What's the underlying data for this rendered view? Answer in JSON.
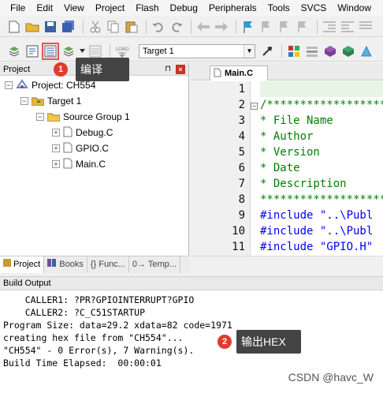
{
  "menu": [
    "File",
    "Edit",
    "View",
    "Project",
    "Flash",
    "Debug",
    "Peripherals",
    "Tools",
    "SVCS",
    "Window",
    "He"
  ],
  "toolbar": {
    "target_value": "Target 1"
  },
  "project_panel": {
    "title": "Project",
    "tree": {
      "project": "Project: CH554",
      "target": "Target 1",
      "group": "Source Group 1",
      "files": [
        "Debug.C",
        "GPIO.C",
        "Main.C"
      ]
    },
    "tabs": [
      "Project",
      "Books",
      "{} Func...",
      "0→ Temp..."
    ]
  },
  "editor": {
    "tab": "Main.C",
    "line_numbers": [
      "1",
      "2",
      "3",
      "4",
      "5",
      "6",
      "7",
      "8",
      "9",
      "10",
      "11"
    ],
    "lines": [
      "",
      "/*******************",
      "* File Name",
      "* Author",
      "* Version",
      "* Date",
      "* Description",
      "*******************",
      "#include \"..\\Publ",
      "#include \"..\\Publ",
      "#include \"GPIO.H\""
    ]
  },
  "output": {
    "title": "Build Output",
    "lines": [
      "    CALLER1: ?PR?GPIOINTERRUPT?GPIO",
      "    CALLER2: ?C_C51STARTUP",
      "Program Size: data=29.2 xdata=82 code=1971",
      "creating hex file from \"CH554\"...",
      "\"CH554\" - 0 Error(s), 7 Warning(s).",
      "Build Time Elapsed:  00:00:01"
    ]
  },
  "annotations": {
    "badge1": "1",
    "label1": "编译",
    "badge2": "2",
    "label2": "输出HEX"
  },
  "watermark": "CSDN @havc_W",
  "colors": {
    "accent_red": "#e03b2c",
    "callout_bg": "#444444",
    "comment_green": "#008000"
  }
}
